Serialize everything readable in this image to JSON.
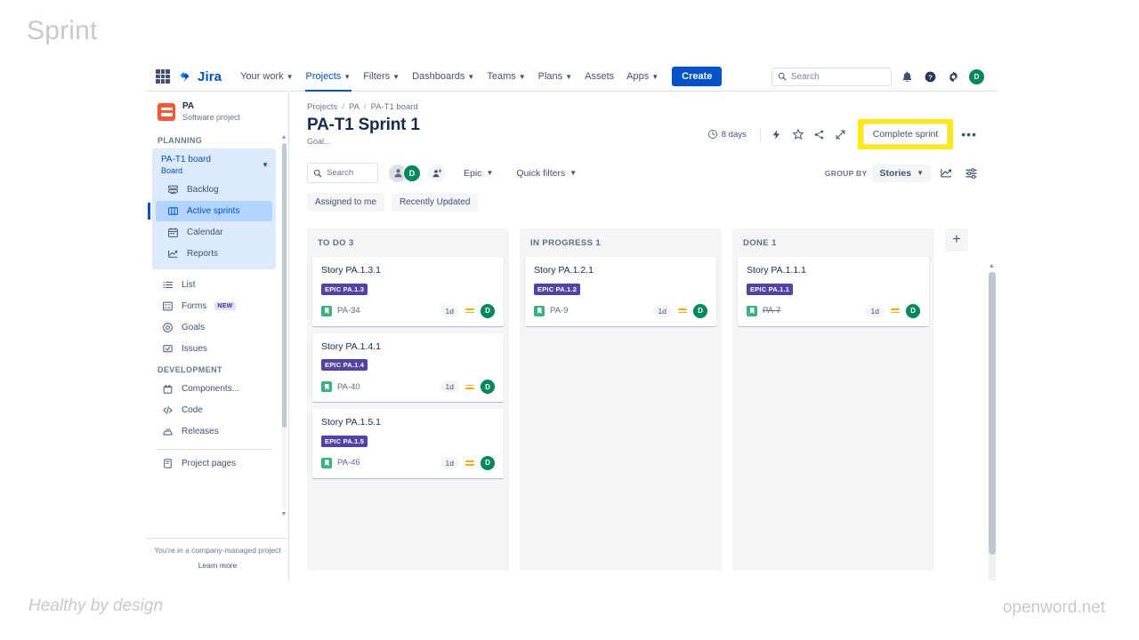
{
  "slide": {
    "title": "Sprint",
    "footer_left": "Healthy by design",
    "footer_right": "openword.net"
  },
  "topnav": {
    "brand": "Jira",
    "items": [
      {
        "label": "Your work",
        "caret": true,
        "active": false
      },
      {
        "label": "Projects",
        "caret": true,
        "active": true
      },
      {
        "label": "Filters",
        "caret": true,
        "active": false
      },
      {
        "label": "Dashboards",
        "caret": true,
        "active": false
      },
      {
        "label": "Teams",
        "caret": true,
        "active": false
      },
      {
        "label": "Plans",
        "caret": true,
        "active": false
      },
      {
        "label": "Assets",
        "caret": false,
        "active": false
      },
      {
        "label": "Apps",
        "caret": true,
        "active": false
      }
    ],
    "create_label": "Create",
    "search_placeholder": "Search",
    "avatar_initial": "D"
  },
  "sidebar": {
    "project_name": "PA",
    "project_type": "Software project",
    "planning_label": "PLANNING",
    "board_name": "PA-T1 board",
    "board_sub": "Board",
    "planning_items": [
      {
        "label": "Backlog",
        "icon": "backlog-icon",
        "selected": false
      },
      {
        "label": "Active sprints",
        "icon": "board-icon",
        "selected": true
      },
      {
        "label": "Calendar",
        "icon": "calendar-icon",
        "selected": false
      },
      {
        "label": "Reports",
        "icon": "reports-icon",
        "selected": false
      }
    ],
    "general_items": [
      {
        "label": "List",
        "icon": "list-icon",
        "badge": ""
      },
      {
        "label": "Forms",
        "icon": "forms-icon",
        "badge": "NEW"
      },
      {
        "label": "Goals",
        "icon": "goals-icon",
        "badge": ""
      },
      {
        "label": "Issues",
        "icon": "issues-icon",
        "badge": ""
      }
    ],
    "development_label": "DEVELOPMENT",
    "development_items": [
      {
        "label": "Components...",
        "icon": "components-icon"
      },
      {
        "label": "Code",
        "icon": "code-icon"
      },
      {
        "label": "Releases",
        "icon": "releases-icon"
      }
    ],
    "bottom_items": [
      {
        "label": "Project pages",
        "icon": "pages-icon"
      }
    ],
    "footer_note": "You're in a company-managed project",
    "footer_link": "Learn more"
  },
  "main": {
    "breadcrumb": [
      "Projects",
      "PA",
      "PA-T1 board"
    ],
    "page_title": "PA-T1 Sprint 1",
    "goal": "Goal...",
    "days_remaining": "8 days",
    "complete_sprint_label": "Complete sprint",
    "highlight_color": "#ffec00",
    "search_placeholder": "Search",
    "epic_filter_label": "Epic",
    "quick_filters_label": "Quick filters",
    "group_by_label": "GROUP BY",
    "group_by_value": "Stories",
    "chips": [
      "Assigned to me",
      "Recently Updated"
    ],
    "avatar_initial": "D"
  },
  "board": {
    "add_column_label": "+",
    "columns": [
      {
        "name": "TO DO",
        "count": "3",
        "header": "TO DO 3",
        "cards": [
          {
            "title": "Story PA.1.3.1",
            "epic": "EPIC PA.1.3",
            "key": "PA-34",
            "estimate": "1d",
            "priority": "medium",
            "avatar": "D",
            "done": false
          },
          {
            "title": "Story PA.1.4.1",
            "epic": "EPIC PA.1.4",
            "key": "PA-40",
            "estimate": "1d",
            "priority": "medium",
            "avatar": "D",
            "done": false
          },
          {
            "title": "Story PA.1.5.1",
            "epic": "EPIC PA.1.5",
            "key": "PA-46",
            "estimate": "1d",
            "priority": "medium",
            "avatar": "D",
            "done": false
          }
        ]
      },
      {
        "name": "IN PROGRESS",
        "count": "1",
        "header": "IN PROGRESS 1",
        "cards": [
          {
            "title": "Story PA.1.2.1",
            "epic": "EPIC PA.1.2",
            "key": "PA-9",
            "estimate": "1d",
            "priority": "medium",
            "avatar": "D",
            "done": false
          }
        ]
      },
      {
        "name": "DONE",
        "count": "1",
        "header": "DONE 1",
        "cards": [
          {
            "title": "Story PA.1.1.1",
            "epic": "EPIC PA.1.1",
            "key": "PA-7",
            "estimate": "1d",
            "priority": "medium",
            "avatar": "D",
            "done": true
          }
        ]
      }
    ]
  },
  "colors": {
    "brand_blue": "#0052cc",
    "epic_purple": "#5243aa",
    "avatar_green": "#00875a",
    "story_green": "#36b37e",
    "priority_orange": "#ffab00",
    "highlight_yellow": "#ffec00"
  }
}
